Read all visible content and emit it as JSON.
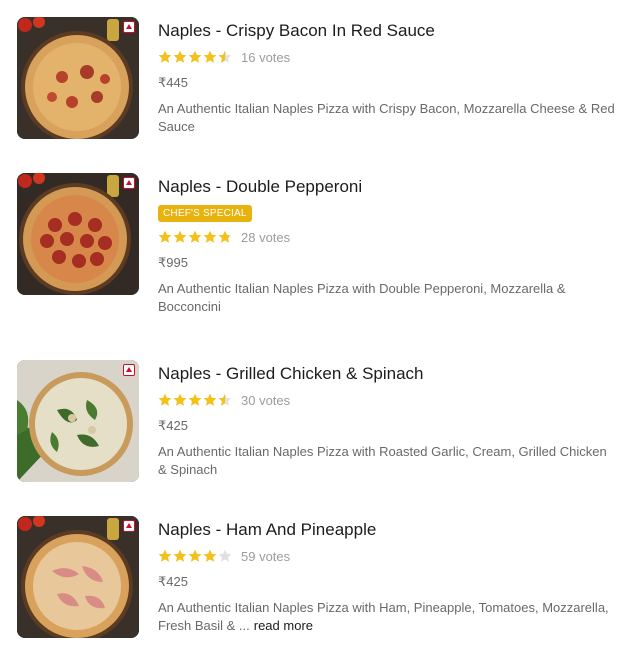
{
  "items": [
    {
      "title": "Naples - Crispy Bacon In Red Sauce",
      "badge": "",
      "rating": 4.5,
      "votes": "16 votes",
      "price": "₹445",
      "description": "An Authentic Italian Naples Pizza with Crispy Bacon, Mozzarella Cheese & Red Sauce",
      "read_more": ""
    },
    {
      "title": "Naples - Double Pepperoni",
      "badge": "CHEF'S SPECIAL",
      "rating": 4.8,
      "votes": "28 votes",
      "price": "₹995",
      "description": "An Authentic Italian Naples Pizza with Double Pepperoni, Mozzarella & Bocconcini",
      "read_more": ""
    },
    {
      "title": "Naples - Grilled Chicken & Spinach",
      "badge": "",
      "rating": 4.5,
      "votes": "30 votes",
      "price": "₹425",
      "description": "An Authentic Italian Naples Pizza with Roasted Garlic, Cream, Grilled Chicken & Spinach",
      "read_more": ""
    },
    {
      "title": "Naples - Ham And Pineapple",
      "badge": "",
      "rating": 4.0,
      "votes": "59 votes",
      "price": "₹425",
      "description": "An Authentic Italian Naples Pizza with Ham, Pineapple, Tomatoes, Mozzarella, Fresh Basil & ...",
      "read_more": "read more"
    }
  ],
  "colors": {
    "star_filled": "#f3c117",
    "star_empty": "#e0e0e0",
    "badge_bg": "#e8b30e",
    "nonveg_mark": "#c8102e"
  },
  "icons": {
    "star": "star-icon",
    "diet": "non-veg-icon"
  }
}
